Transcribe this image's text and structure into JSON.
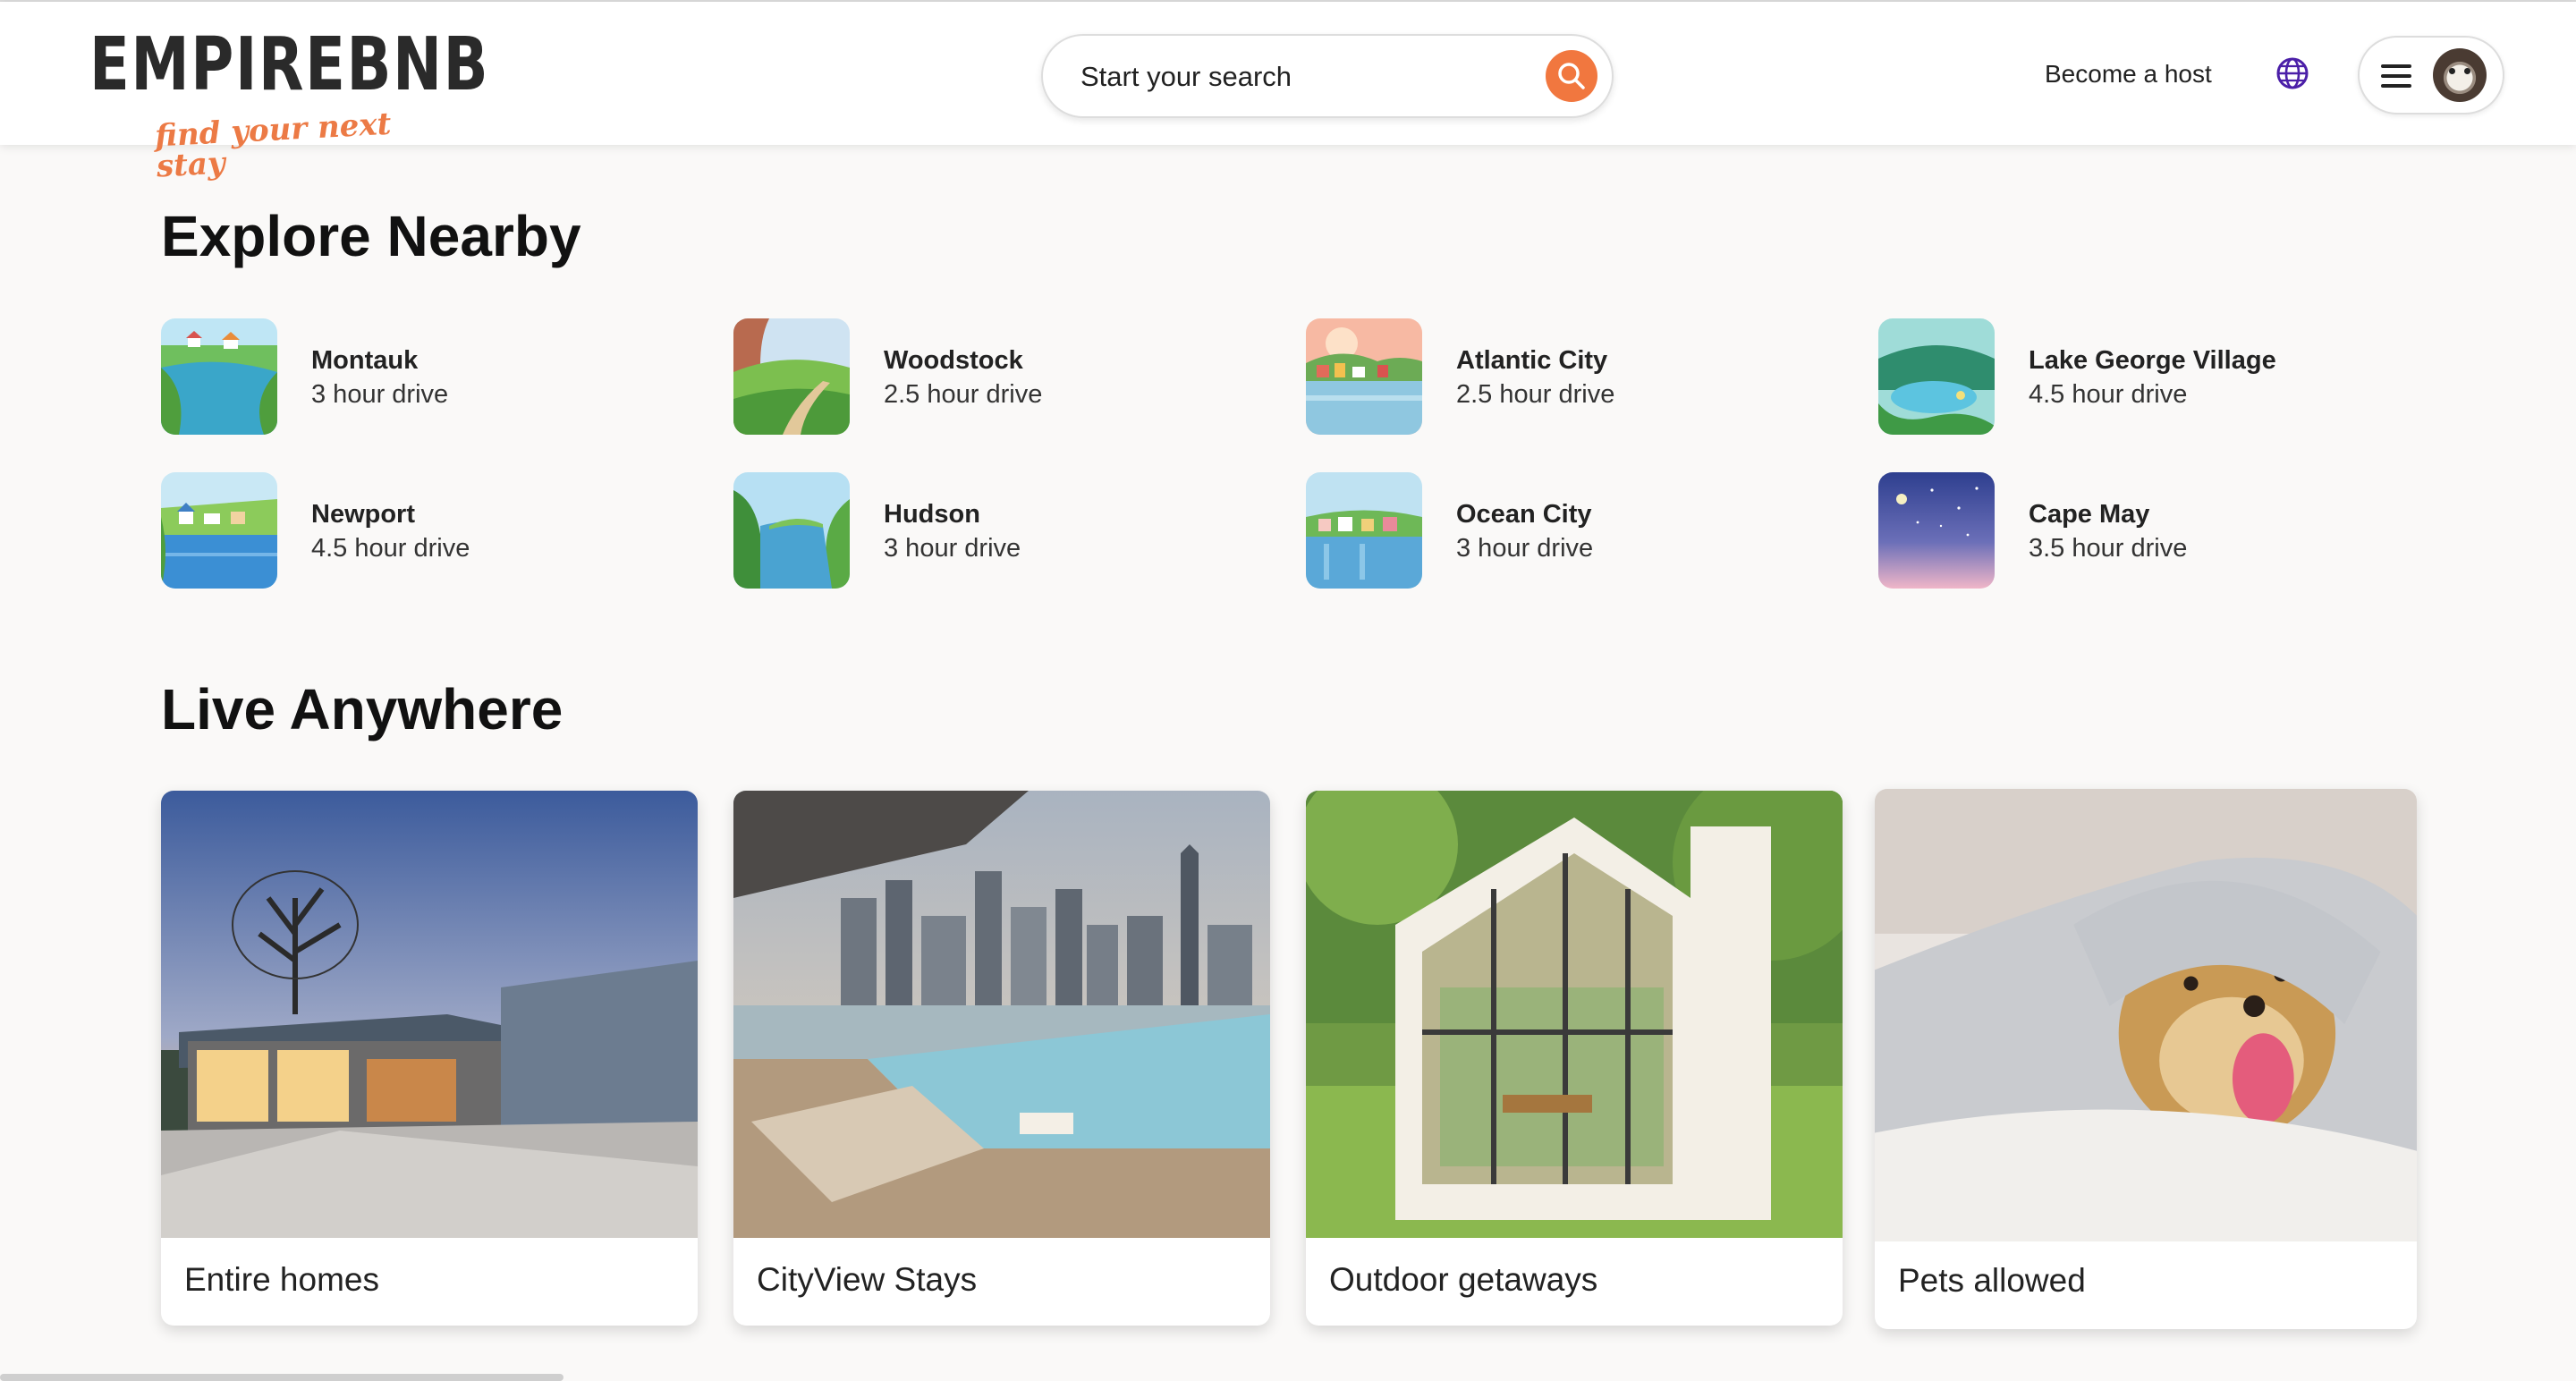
{
  "brand": {
    "name": "EMPIREBNB",
    "tagline": "find your next stay"
  },
  "header": {
    "search_placeholder": "Start your search",
    "become_host": "Become a host",
    "icons": [
      "search-icon",
      "globe-icon",
      "menu-icon",
      "avatar"
    ]
  },
  "explore": {
    "title": "Explore Nearby",
    "items": [
      {
        "name": "Montauk",
        "drive": "3 hour drive"
      },
      {
        "name": "Woodstock",
        "drive": "2.5 hour drive"
      },
      {
        "name": "Atlantic City",
        "drive": "2.5 hour drive"
      },
      {
        "name": "Lake George Village",
        "drive": "4.5 hour drive"
      },
      {
        "name": "Newport",
        "drive": "4.5 hour drive"
      },
      {
        "name": "Hudson",
        "drive": "3 hour drive"
      },
      {
        "name": "Ocean City",
        "drive": "3 hour drive"
      },
      {
        "name": "Cape May",
        "drive": "3.5 hour drive"
      }
    ]
  },
  "live": {
    "title": "Live Anywhere",
    "cards": [
      {
        "label": "Entire homes"
      },
      {
        "label": "CityView Stays"
      },
      {
        "label": "Outdoor getaways"
      },
      {
        "label": "Pets allowed"
      }
    ]
  },
  "colors": {
    "accent": "#f1773f",
    "globe": "#4b1fa8",
    "background": "#faf9f8"
  }
}
